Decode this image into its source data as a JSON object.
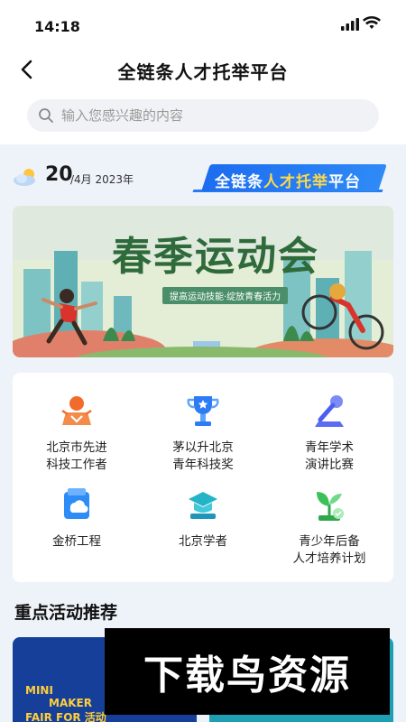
{
  "status_bar": {
    "time": "14:18"
  },
  "nav": {
    "title": "全链条人才托举平台",
    "back_icon": "chevron-left-icon"
  },
  "search": {
    "placeholder": "输入您感兴趣的内容",
    "value": ""
  },
  "date": {
    "day": "20",
    "rest": "/4月 2023年",
    "weather_icon": "cloud-sun-icon"
  },
  "platform_badge": {
    "prefix": "全链条",
    "highlight": "人才托举",
    "suffix": "平台"
  },
  "banner": {
    "title": "春季运动会",
    "subtitle": "提高运动技能·绽放青春活力"
  },
  "services": [
    {
      "label": "北京市先进\n科技工作者",
      "icon": "award-ribbon-icon",
      "color": "#f26b2c"
    },
    {
      "label": "茅以升北京\n青年科技奖",
      "icon": "trophy-icon",
      "color": "#2d7cf6"
    },
    {
      "label": "青年学术\n演讲比赛",
      "icon": "microphone-icon",
      "color": "#5a6cf2"
    },
    {
      "label": "金桥工程",
      "icon": "cloud-document-icon",
      "color": "#2d8cf6"
    },
    {
      "label": "北京学者",
      "icon": "graduation-cap-icon",
      "color": "#25b3c7"
    },
    {
      "label": "青少年后备\n人才培养计划",
      "icon": "sprout-icon",
      "color": "#3cc15a"
    }
  ],
  "recommend": {
    "title": "重点活动推荐",
    "card1": {
      "line1": "MINI",
      "line2": "MAKER",
      "line3": "FAIR FOR 活动"
    }
  },
  "watermark": {
    "text": "下载鸟资源"
  }
}
